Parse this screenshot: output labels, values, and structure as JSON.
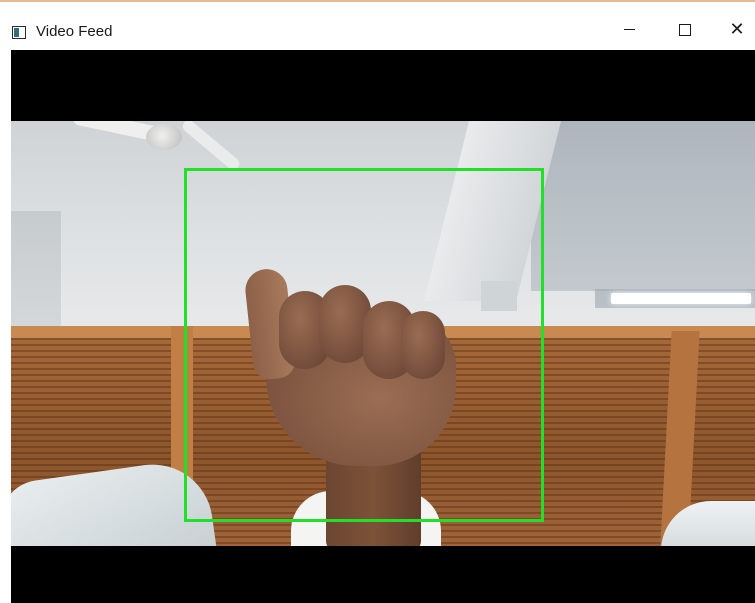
{
  "window": {
    "title": "Video Feed",
    "icon": "window-app-icon",
    "controls": {
      "minimize": "minimize-icon",
      "maximize": "maximize-icon",
      "close_icon": "close-icon",
      "close_glyph": "✕"
    }
  },
  "video": {
    "background": "#000000",
    "detection_box_color": "#22e02a",
    "scene": "hand-fist-webcam-frame"
  }
}
